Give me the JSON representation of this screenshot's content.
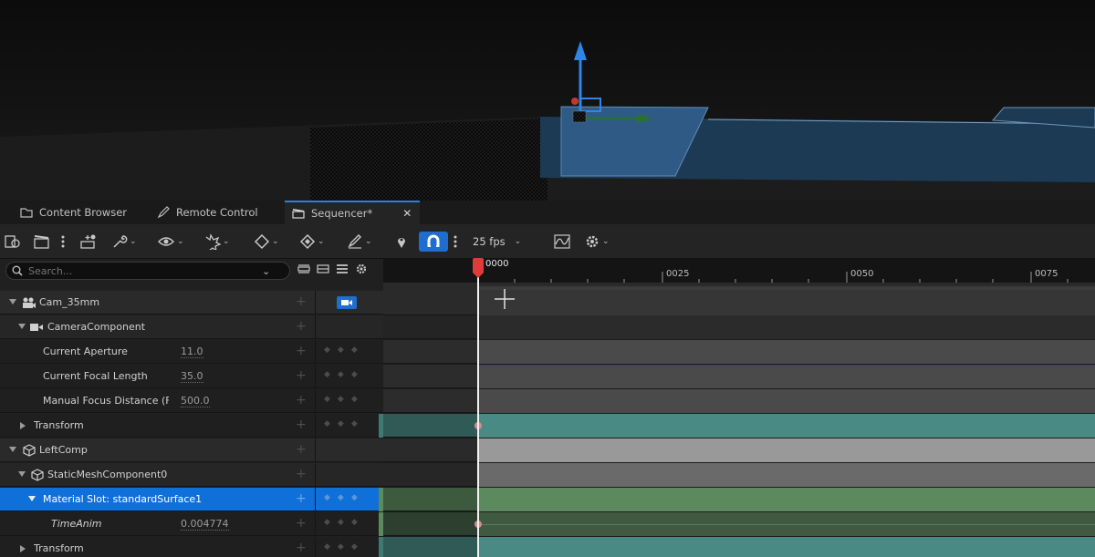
{
  "tabs": [
    {
      "label": "Content Browser",
      "icon": "folder-icon"
    },
    {
      "label": "Remote Control",
      "icon": "pen-icon"
    },
    {
      "label": "Sequencer*",
      "icon": "clapper-icon",
      "active": true,
      "close": "✕"
    }
  ],
  "toolbar": {
    "fps_label": "25 fps",
    "icons": [
      "world-browse-icon",
      "clapper-icon",
      "more-icon",
      "actor-add-icon",
      "wrench-icon",
      "eye-icon",
      "gear-burst-icon",
      "key-icon",
      "diamond-icon",
      "pen-icon",
      "pin-icon",
      "magnet-icon",
      "curve-editor-icon",
      "settings-icon"
    ]
  },
  "search": {
    "placeholder": "Search..."
  },
  "timeline": {
    "playhead": "0000",
    "ticks": [
      "0025",
      "0050",
      "0075"
    ]
  },
  "tracks": [
    {
      "label": "Cam_35mm",
      "type": "header"
    },
    {
      "label": "CameraComponent",
      "type": "sub"
    },
    {
      "label": "Current Aperture",
      "type": "prop",
      "value": "11.0"
    },
    {
      "label": "Current Focal Length",
      "type": "prop",
      "value": "35.0"
    },
    {
      "label": "Manual Focus Distance (Focus Distance)",
      "type": "prop",
      "value": "500.0"
    },
    {
      "label": "Transform",
      "type": "prop"
    },
    {
      "label": "LeftComp",
      "type": "header"
    },
    {
      "label": "StaticMeshComponent0",
      "type": "sub"
    },
    {
      "label": "Material Slot: standardSurface1",
      "type": "selected"
    },
    {
      "label": "TimeAnim",
      "type": "prop",
      "value": "0.004774"
    },
    {
      "label": "Transform",
      "type": "prop"
    }
  ],
  "colors": {
    "accent": "#0f70da",
    "transform_track": "#3f7a72",
    "material_track": "#5c8a5e",
    "component_track": "#8c8c8c",
    "playhead": "#e03a3a"
  }
}
